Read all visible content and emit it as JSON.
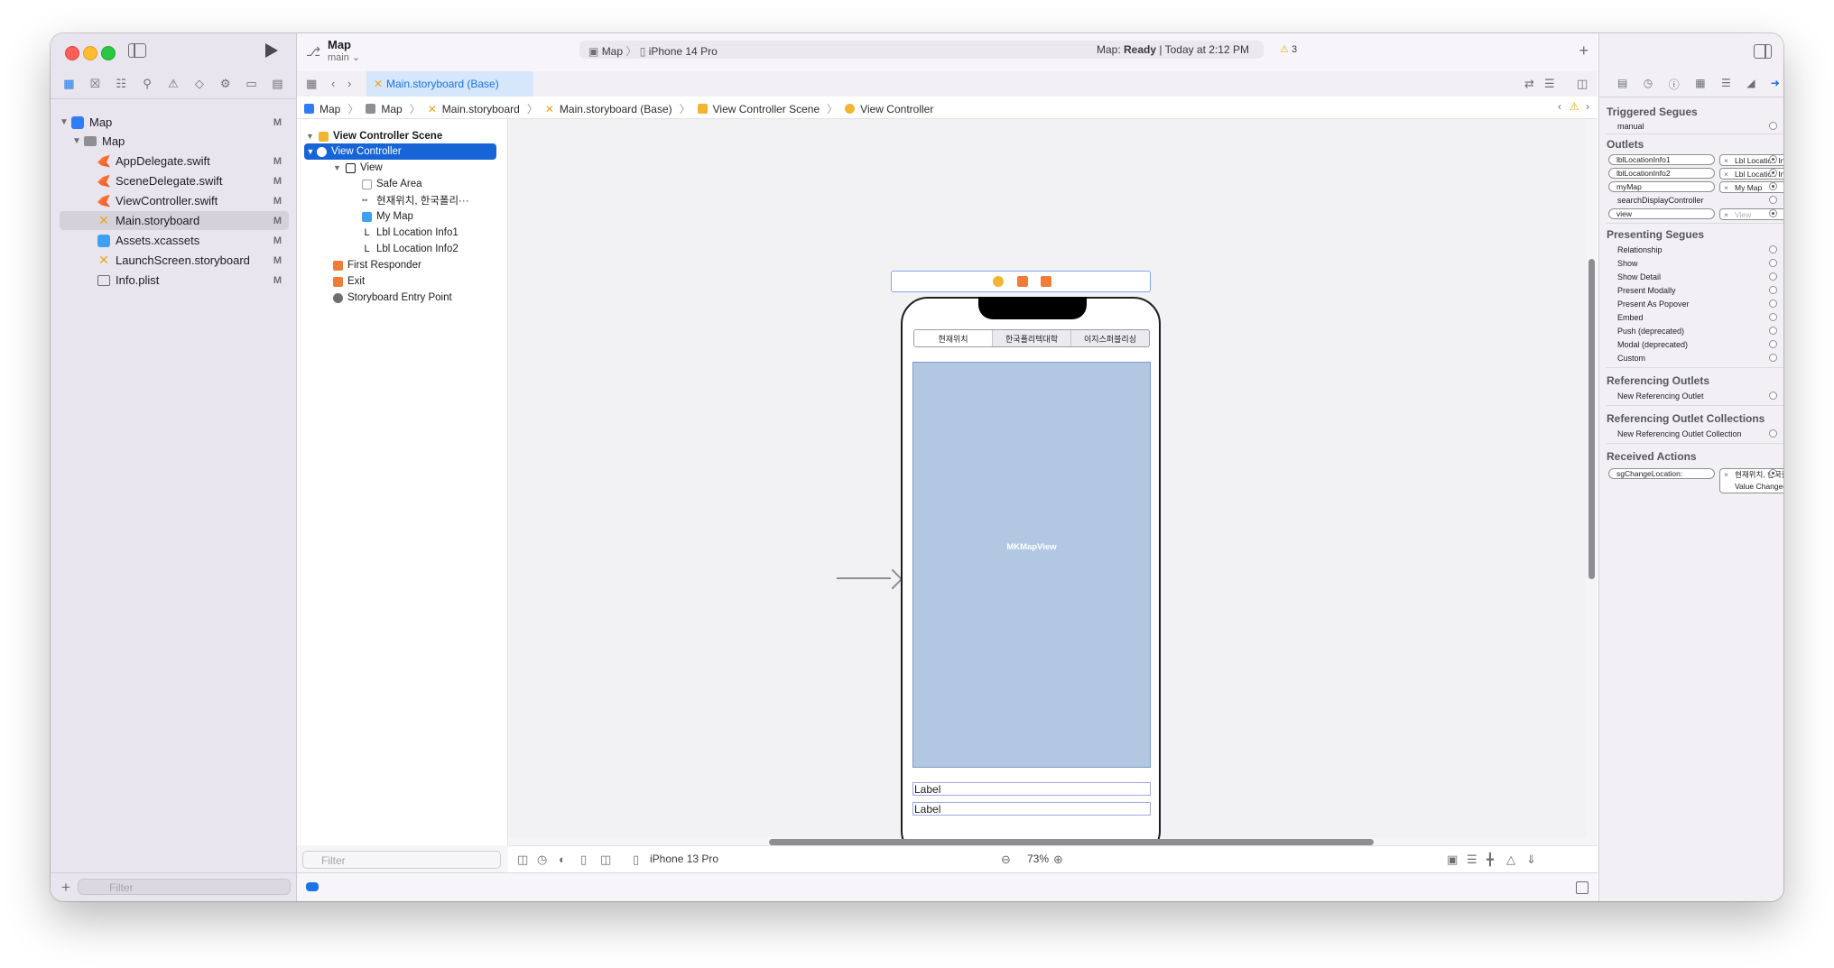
{
  "project": {
    "name": "Map",
    "branch": "main"
  },
  "toolbar": {
    "scheme": "Map",
    "device": "iPhone 14 Pro",
    "status_prefix": "Map: ",
    "status_state": "Ready",
    "status_suffix": " | Today at 2:12 PM",
    "warnings": "3"
  },
  "navigator": {
    "items": [
      {
        "label": "Map",
        "m": "M"
      },
      {
        "label": "Map",
        "m": ""
      },
      {
        "label": "AppDelegate.swift",
        "m": "M"
      },
      {
        "label": "SceneDelegate.swift",
        "m": "M"
      },
      {
        "label": "ViewController.swift",
        "m": "M"
      },
      {
        "label": "Main.storyboard",
        "m": "M"
      },
      {
        "label": "Assets.xcassets",
        "m": "M"
      },
      {
        "label": "LaunchScreen.storyboard",
        "m": "M"
      },
      {
        "label": "Info.plist",
        "m": "M"
      }
    ],
    "filter_placeholder": "Filter"
  },
  "editor_tab": "Main.storyboard (Base)",
  "breadcrumb": [
    "Map",
    "Map",
    "Main.storyboard",
    "Main.storyboard (Base)",
    "View Controller Scene",
    "View Controller"
  ],
  "outline": {
    "scene": "View Controller Scene",
    "rows": [
      "View Controller",
      "View",
      "Safe Area",
      "현재위치, 한국폴리···",
      "My Map",
      "Lbl Location Info1",
      "Lbl Location Info2",
      "First Responder",
      "Exit",
      "Storyboard Entry Point"
    ],
    "filter_placeholder": "Filter"
  },
  "canvas": {
    "segments": [
      "현재위치",
      "한국폴리텍대학",
      "이지스퍼블리싱"
    ],
    "map_label": "MKMapView",
    "label1": "Label",
    "label2": "Label"
  },
  "bottom": {
    "device": "iPhone 13 Pro",
    "zoom": "73%"
  },
  "inspector": {
    "triggered_segues": {
      "title": "Triggered Segues",
      "items": [
        "manual"
      ]
    },
    "outlets": {
      "title": "Outlets",
      "items": [
        {
          "name": "lblLocationInfo1",
          "target": "Lbl Location Inf..."
        },
        {
          "name": "lblLocationInfo2",
          "target": "Lbl Location Inf..."
        },
        {
          "name": "myMap",
          "target": "My Map"
        },
        {
          "name": "searchDisplayController",
          "target": ""
        },
        {
          "name": "view",
          "target": "View"
        }
      ]
    },
    "presenting_segues": {
      "title": "Presenting Segues",
      "items": [
        "Relationship",
        "Show",
        "Show Detail",
        "Present Modally",
        "Present As Popover",
        "Embed",
        "Push (deprecated)",
        "Modal (deprecated)",
        "Custom"
      ]
    },
    "referencing_outlets": {
      "title": "Referencing Outlets",
      "items": [
        "New Referencing Outlet"
      ]
    },
    "referencing_outlet_collections": {
      "title": "Referencing Outlet Collections",
      "items": [
        "New Referencing Outlet Collection"
      ]
    },
    "received_actions": {
      "title": "Received Actions",
      "action": "sgChangeLocation:",
      "target": "현재위치, 한국폴리···",
      "event": "Value Changed"
    }
  }
}
